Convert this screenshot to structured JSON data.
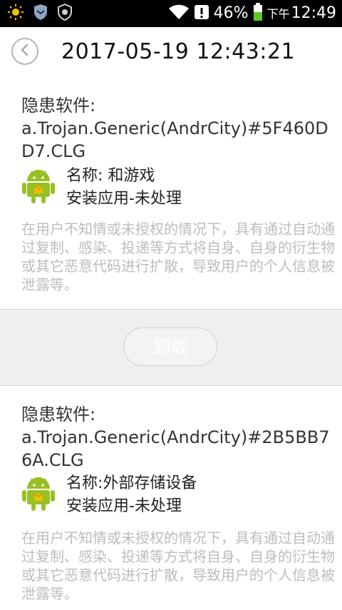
{
  "status_bar": {
    "battery": "46%",
    "time_prefix": "下午",
    "time": "12:49",
    "icons": [
      "sun-icon",
      "shield-icon",
      "badge-icon",
      "wifi-icon",
      "alert-icon",
      "battery-icon"
    ]
  },
  "header": {
    "title": "2017-05-19 12:43:21",
    "back_icon": "chevron-left-icon"
  },
  "entries": [
    {
      "label": "隐患软件:",
      "name": "a.Trojan.Generic(AndrCity)#5F460DD7.CLG",
      "app_name": "名称: 和游戏",
      "status": "安装应用-未处理",
      "description": "在用户不知情或未授权的情况下，具有通过自动通过复制、感染、投递等方式将自身、自身的衍生物或其它恶意代码进行扩散，导致用户的个人信息被泄露等。"
    },
    {
      "label": "隐患软件:",
      "name": "a.Trojan.Generic(AndrCity)#2B5BB76A.CLG",
      "app_name": "名称:外部存储设备",
      "status": "安装应用-未处理",
      "description": "在用户不知情或未授权的情况下，具有通过自动通过复制、感染、投递等方式将自身、自身的衍生物或其它恶意代码进行扩散，导致用户的个人信息被泄露等。"
    }
  ],
  "actions": {
    "uninstall_label": "卸载"
  },
  "colors": {
    "android_green": "#97C024",
    "description_gray": "#BDBDBD",
    "action_bg": "#EFEFEF"
  }
}
